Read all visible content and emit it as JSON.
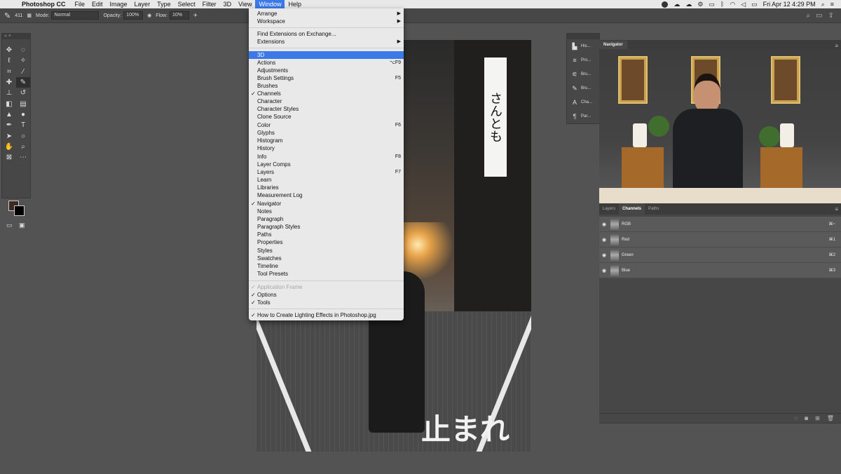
{
  "menubar": {
    "app_name": "Photoshop CC",
    "items": [
      "File",
      "Edit",
      "Image",
      "Layer",
      "Type",
      "Select",
      "Filter",
      "3D",
      "View",
      "Window",
      "Help"
    ],
    "active_item": "Window",
    "clock": "Fri Apr 12  4:29 PM"
  },
  "options_bar": {
    "brush_size": "411",
    "mode_label": "Mode:",
    "mode_value": "Normal",
    "opacity_label": "Opacity:",
    "opacity_value": "100%",
    "flow_label": "Flow:",
    "flow_value": "10%"
  },
  "window_menu": {
    "items": [
      {
        "label": "Arrange",
        "submenu": true
      },
      {
        "label": "Workspace",
        "submenu": true
      },
      {
        "label": "Find Extensions on Exchange..."
      },
      {
        "label": "Extensions",
        "submenu": true
      },
      {
        "label": "3D",
        "highlighted": true
      },
      {
        "label": "Actions",
        "shortcut": "⌥F9"
      },
      {
        "label": "Adjustments"
      },
      {
        "label": "Brush Settings",
        "shortcut": "F5"
      },
      {
        "label": "Brushes"
      },
      {
        "label": "Channels",
        "checked": true
      },
      {
        "label": "Character"
      },
      {
        "label": "Character Styles"
      },
      {
        "label": "Clone Source"
      },
      {
        "label": "Color",
        "shortcut": "F6"
      },
      {
        "label": "Glyphs"
      },
      {
        "label": "Histogram"
      },
      {
        "label": "History"
      },
      {
        "label": "Info",
        "shortcut": "F8"
      },
      {
        "label": "Layer Comps"
      },
      {
        "label": "Layers",
        "shortcut": "F7"
      },
      {
        "label": "Learn"
      },
      {
        "label": "Libraries"
      },
      {
        "label": "Measurement Log"
      },
      {
        "label": "Navigator",
        "checked": true
      },
      {
        "label": "Notes"
      },
      {
        "label": "Paragraph"
      },
      {
        "label": "Paragraph Styles"
      },
      {
        "label": "Paths"
      },
      {
        "label": "Properties"
      },
      {
        "label": "Styles"
      },
      {
        "label": "Swatches"
      },
      {
        "label": "Timeline"
      },
      {
        "label": "Tool Presets"
      },
      {
        "label": "Application Frame",
        "checked": true,
        "disabled": true
      },
      {
        "label": "Options",
        "checked": true
      },
      {
        "label": "Tools",
        "checked": true
      },
      {
        "label": "How to Create Lighting Effects in Photoshop.jpg",
        "checked": true
      }
    ]
  },
  "icon_strip": {
    "items": [
      {
        "label": "His...",
        "icon": "histogram-icon"
      },
      {
        "label": "Pro...",
        "icon": "properties-icon"
      },
      {
        "label": "Bru...",
        "icon": "brush-settings-icon"
      },
      {
        "label": "Bru...",
        "icon": "brush-icon"
      },
      {
        "label": "Cha...",
        "icon": "character-icon"
      },
      {
        "label": "Par...",
        "icon": "paragraph-icon"
      }
    ]
  },
  "navigator": {
    "tab": "Navigator"
  },
  "channels_panel": {
    "tabs": [
      "Layers",
      "Channels",
      "Paths"
    ],
    "active_tab": "Channels",
    "rows": [
      {
        "name": "RGB",
        "shortcut": "⌘~"
      },
      {
        "name": "Red",
        "shortcut": "⌘1"
      },
      {
        "name": "Green",
        "shortcut": "⌘2"
      },
      {
        "name": "Blue",
        "shortcut": "⌘3"
      }
    ]
  },
  "canvas": {
    "sign_text": "さんとも",
    "road_text": "止まれ"
  },
  "colors": {
    "menu_highlight": "#3b79e8",
    "foreground": "#3a2a22",
    "background": "#000000"
  }
}
